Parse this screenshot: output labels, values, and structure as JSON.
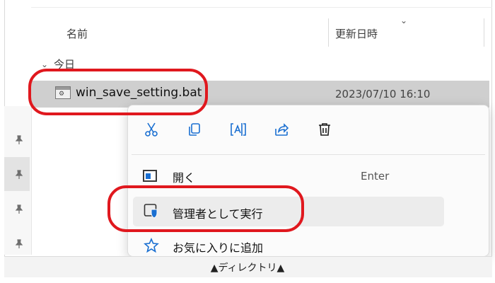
{
  "header": {
    "col_name": "名前",
    "col_date": "更新日時",
    "col_caret": "⌄"
  },
  "group": {
    "chevron": "⌄",
    "label": "今日"
  },
  "file": {
    "icon": "bat-file-icon",
    "name": "win_save_setting.bat",
    "modified": "2023/07/10 16:10"
  },
  "context_menu": {
    "toolbar": [
      "cut-icon",
      "copy-icon",
      "rename-icon",
      "share-icon",
      "delete-icon"
    ],
    "items": [
      {
        "label": "開く",
        "shortcut": "Enter",
        "icon": "open-icon"
      },
      {
        "label": "管理者として実行",
        "icon": "shield-icon"
      },
      {
        "label": "お気に入りに追加",
        "icon": "star-icon"
      }
    ]
  },
  "nav": {
    "pins": [
      "pin-icon",
      "pin-icon",
      "pin-icon",
      "pin-icon"
    ]
  },
  "bottom": {
    "label": "▲ディレクトリ▲"
  },
  "colors": {
    "annotation": "#e0181e",
    "selection": "#cfcfcf",
    "accent": "#1a6fd1"
  }
}
